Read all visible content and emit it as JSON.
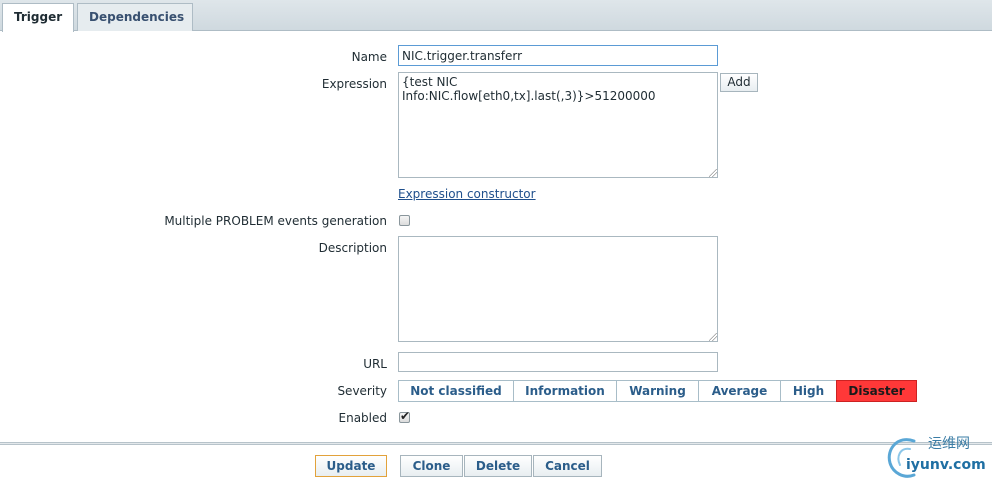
{
  "tabs": [
    {
      "label": "Trigger",
      "active": true
    },
    {
      "label": "Dependencies",
      "active": false
    }
  ],
  "form": {
    "name_label": "Name",
    "name_value": "NIC.trigger.transferr",
    "expression_label": "Expression",
    "expression_value": "{test NIC\nInfo:NIC.flow[eth0,tx].last(,3)}>51200000",
    "add_label": "Add",
    "expression_constructor_label": "Expression constructor",
    "multiple_label": "Multiple PROBLEM events generation",
    "multiple_checked": false,
    "description_label": "Description",
    "description_value": "",
    "url_label": "URL",
    "url_value": "",
    "severity_label": "Severity",
    "severity_options": [
      "Not classified",
      "Information",
      "Warning",
      "Average",
      "High",
      "Disaster"
    ],
    "severity_selected": "Disaster",
    "enabled_label": "Enabled",
    "enabled_checked": true
  },
  "footer": {
    "update_label": "Update",
    "clone_label": "Clone",
    "delete_label": "Delete",
    "cancel_label": "Cancel"
  },
  "watermark": {
    "top_text": "运维网",
    "bottom_text": "iyunv.com"
  },
  "colors": {
    "disaster": "#ff3838",
    "accent": "#2b5d8a",
    "primary_border": "#e2a23b"
  }
}
